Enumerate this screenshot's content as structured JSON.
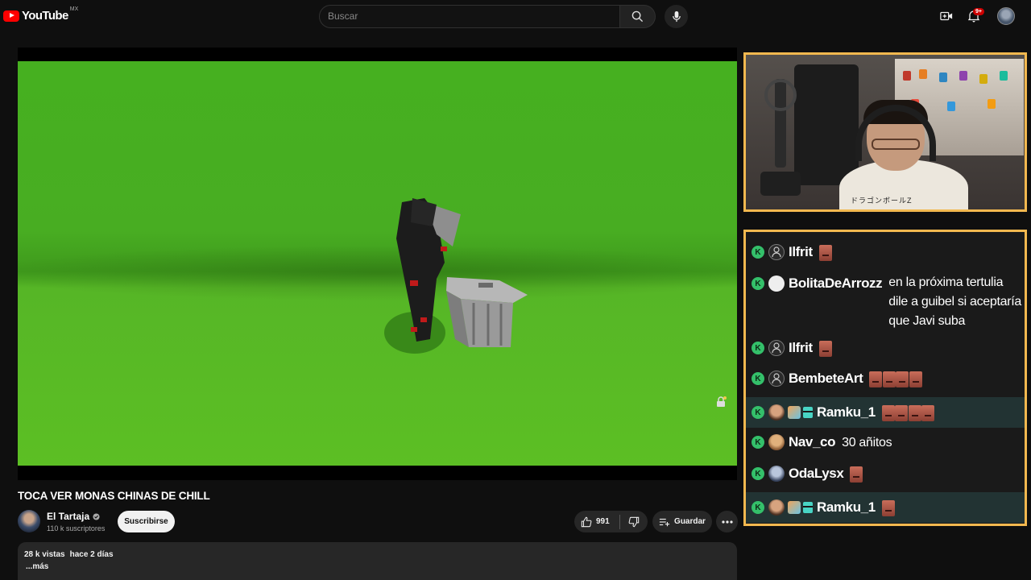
{
  "header": {
    "logo_text": "YouTube",
    "logo_country": "MX",
    "search_placeholder": "Buscar",
    "notification_count": "9+",
    "accent_color": "#ff0000"
  },
  "video": {
    "title": "TOCA VER MONAS CHINAS DE CHILL",
    "channel_name": "El Tartaja",
    "subscribers": "110 k suscriptores",
    "subscribe_label": "Suscribirse",
    "likes": "991",
    "save_label": "Guardar",
    "views": "28 k vistas",
    "age": "hace 2 días",
    "more_label": "...más"
  },
  "webcam": {
    "shirt_text": "ドラゴンボールZ"
  },
  "chat": {
    "badge_letter": "K",
    "messages": [
      {
        "user": "Ilfrit",
        "avatar": "default",
        "text": "",
        "emotes": 1,
        "highlight": false,
        "sub": false
      },
      {
        "user": "BolitaDeArrozz",
        "avatar": "boli",
        "text": "en la próxima tertulia dile a guibel si aceptaría que Javi suba",
        "emotes": 0,
        "highlight": false,
        "sub": false
      },
      {
        "user": "Ilfrit",
        "avatar": "default",
        "text": "",
        "emotes": 1,
        "highlight": false,
        "sub": false
      },
      {
        "user": "BembeteArt",
        "avatar": "default",
        "text": "",
        "emotes": 4,
        "highlight": false,
        "sub": false
      },
      {
        "user": "Ramku_1",
        "avatar": "face",
        "text": "",
        "emotes": 4,
        "highlight": true,
        "sub": true
      },
      {
        "user": "Nav_co",
        "avatar": "nav",
        "text": "30 añitos",
        "emotes": 0,
        "highlight": false,
        "sub": false
      },
      {
        "user": "OdaLysx",
        "avatar": "oda",
        "text": "",
        "emotes": 1,
        "highlight": false,
        "sub": false
      },
      {
        "user": "Ramku_1",
        "avatar": "face",
        "text": "",
        "emotes": 1,
        "highlight": true,
        "sub": true
      }
    ]
  }
}
